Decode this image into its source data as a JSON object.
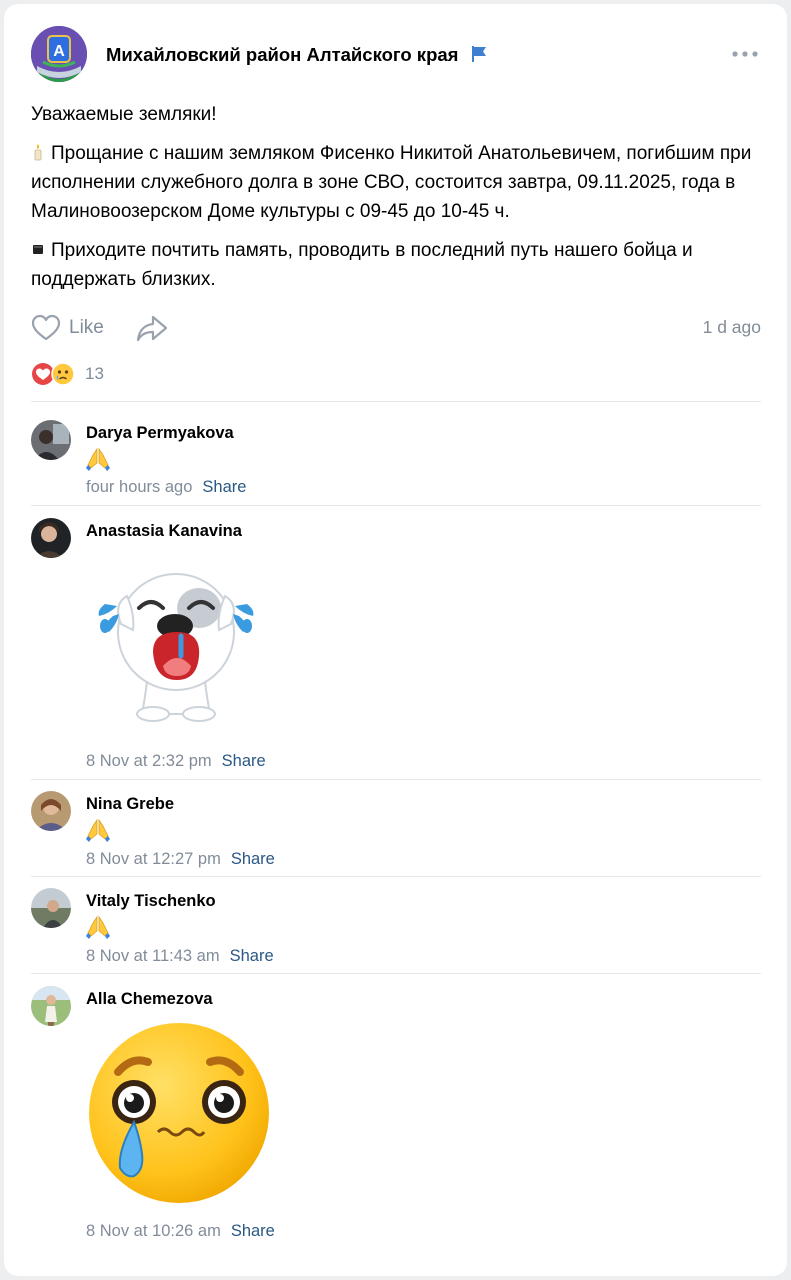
{
  "post": {
    "group_name": "Михайловский район Алтайского края",
    "paragraphs": [
      "Уважаемые земляки!",
      "Прощание с нашим земляком Фисенко Никитой Анатольевичем, погибшим при исполнении служебного долга в зоне СВО, состоится завтра, 09.11.2025, года в Малиновоозерском Доме культуры с 09-45 до 10-45 ч.",
      "Приходите почтить память, проводить в последний путь нашего бойца и поддержать близких."
    ],
    "paragraph_icons": [
      "",
      "candle-icon",
      "black-square-icon"
    ],
    "like_label": "Like",
    "time_ago": "1 d ago",
    "reaction_count": "13",
    "reaction_icons": [
      "heart-reaction-icon",
      "crying-face-reaction-icon"
    ]
  },
  "comments": [
    {
      "author": "Darya Permyakova",
      "content": "folded-hands-emoji",
      "time": "four hours ago",
      "share_label": "Share"
    },
    {
      "author": "Anastasia Kanavina",
      "content": "crying-dog-sticker",
      "time": "8 Nov at 2:32 pm",
      "share_label": "Share"
    },
    {
      "author": "Nina Grebe",
      "content": "folded-hands-emoji",
      "time": "8 Nov at 12:27 pm",
      "share_label": "Share"
    },
    {
      "author": "Vitaly Tischenko",
      "content": "folded-hands-emoji",
      "time": "8 Nov at 11:43 am",
      "share_label": "Share"
    },
    {
      "author": "Alla Chemezova",
      "content": "crying-face-sticker",
      "time": "8 Nov at 10:26 am",
      "share_label": "Share"
    }
  ],
  "colors": {
    "muted_text": "#818c99",
    "link": "#2a5885",
    "divider": "#e7e8ec",
    "background": "#edeef0",
    "flag": "#3f7fd1",
    "reaction_heart": "#e64646"
  }
}
